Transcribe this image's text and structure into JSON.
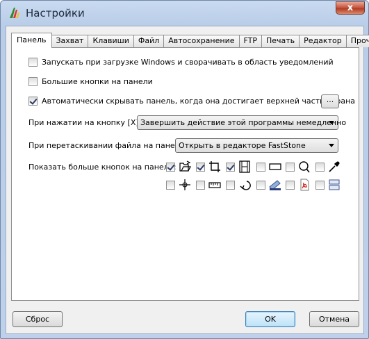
{
  "window": {
    "title": "Настройки",
    "close_glyph": "x"
  },
  "tabs": [
    {
      "label": "Панель",
      "active": true
    },
    {
      "label": "Захват"
    },
    {
      "label": "Клавиши"
    },
    {
      "label": "Файл"
    },
    {
      "label": "Автосохранение"
    },
    {
      "label": "FTP"
    },
    {
      "label": "Печать"
    },
    {
      "label": "Редактор"
    },
    {
      "label": "Прочее"
    }
  ],
  "options": {
    "startup": {
      "label": "Запускать при загрузке Windows и сворачивать в область уведомлений",
      "checked": false
    },
    "big_buttons": {
      "label": "Большие кнопки на панели",
      "checked": false
    },
    "autohide": {
      "label": "Автоматически скрывать панель, когда она достигает верхней части экрана",
      "checked": true,
      "more_button": "..."
    }
  },
  "on_x_click": {
    "label": "При нажатии на кнопку [X]:",
    "value": "Завершить действие этой программы немедленно"
  },
  "on_drag_file": {
    "label": "При перетаскивании файла на панель:",
    "value": "Открыть в редакторе FastStone"
  },
  "extra_buttons": {
    "label": "Показать больше кнопок на панели:",
    "row1": [
      {
        "icon": "open-folder-icon",
        "checked": true
      },
      {
        "icon": "crop-frame-icon",
        "checked": true
      },
      {
        "icon": "film-strip-icon",
        "checked": true
      },
      {
        "icon": "rectangle-icon",
        "checked": false
      },
      {
        "icon": "magnifier-icon",
        "checked": false
      },
      {
        "icon": "eyedropper-icon",
        "checked": false
      }
    ],
    "row2": [
      {
        "icon": "crosshair-icon",
        "checked": false
      },
      {
        "icon": "ruler-icon",
        "checked": false
      },
      {
        "icon": "undo-icon",
        "checked": false
      },
      {
        "icon": "scanner-icon",
        "checked": false
      },
      {
        "icon": "pdf-icon",
        "checked": false
      },
      {
        "icon": "compare-icon",
        "checked": false
      }
    ]
  },
  "footer": {
    "reset": "Сброс",
    "ok": "OK",
    "cancel": "Отмена"
  }
}
